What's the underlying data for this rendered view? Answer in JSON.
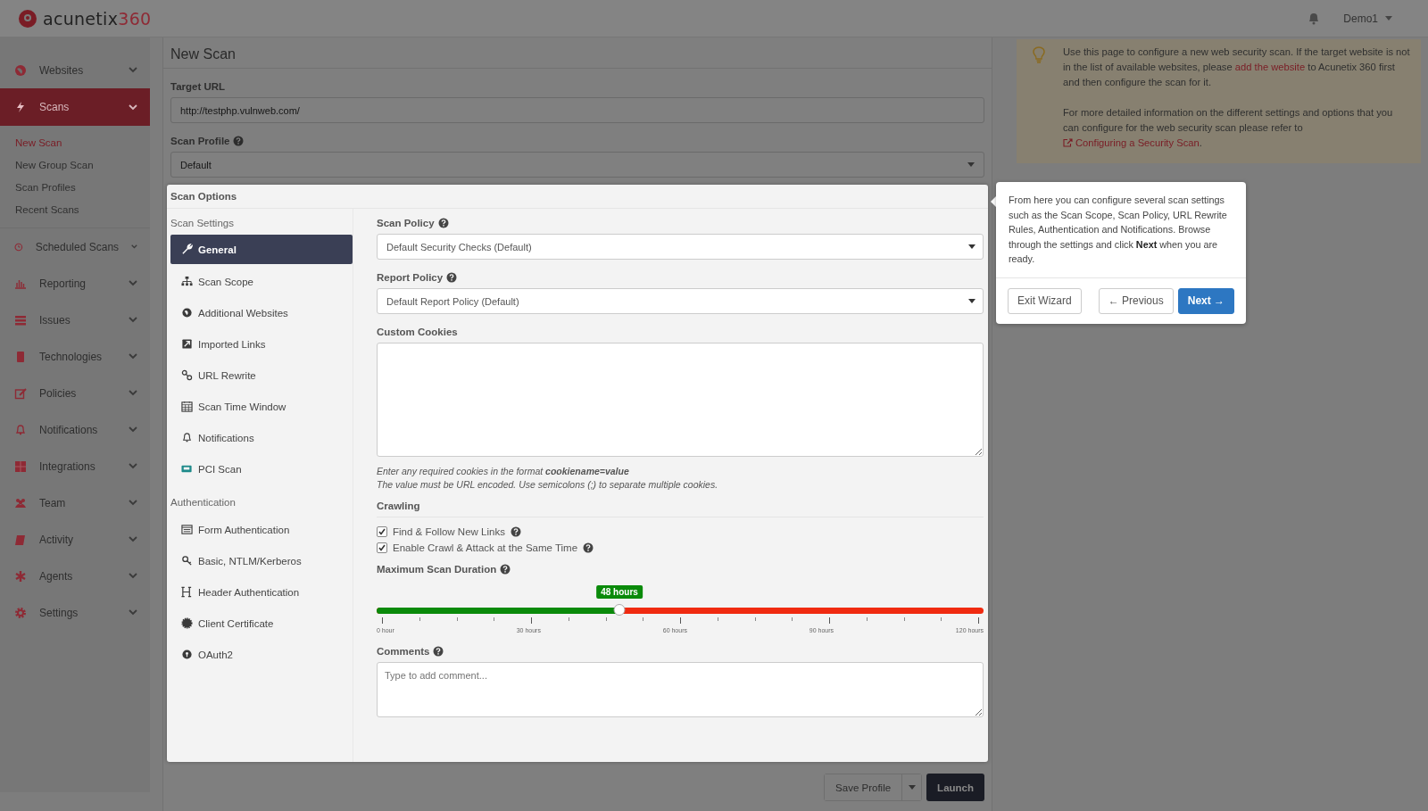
{
  "header": {
    "logo_text": "acunetix",
    "logo_suffix": "360",
    "user": "Demo1"
  },
  "sidebar": {
    "items": [
      {
        "label": "Websites",
        "selected": false
      },
      {
        "label": "Scans",
        "selected": true,
        "children": [
          {
            "label": "New Scan",
            "selected": true
          },
          {
            "label": "New Group Scan",
            "selected": false
          },
          {
            "label": "Scan Profiles",
            "selected": false
          },
          {
            "label": "Recent Scans",
            "selected": false
          }
        ]
      },
      {
        "label": "Scheduled Scans",
        "selected": false
      },
      {
        "label": "Reporting",
        "selected": false
      },
      {
        "label": "Issues",
        "selected": false
      },
      {
        "label": "Technologies",
        "selected": false
      },
      {
        "label": "Policies",
        "selected": false
      },
      {
        "label": "Notifications",
        "selected": false
      },
      {
        "label": "Integrations",
        "selected": false
      },
      {
        "label": "Team",
        "selected": false
      },
      {
        "label": "Activity",
        "selected": false
      },
      {
        "label": "Agents",
        "selected": false
      },
      {
        "label": "Settings",
        "selected": false
      }
    ]
  },
  "page": {
    "title": "New Scan",
    "target_url": {
      "label": "Target URL",
      "value": "http://testphp.vulnweb.com/"
    },
    "scan_profile": {
      "label": "Scan Profile",
      "value": "Default"
    }
  },
  "scan_options": {
    "title": "Scan Options",
    "groups": [
      {
        "heading": "Scan Settings",
        "items": [
          {
            "label": "General",
            "selected": true
          },
          {
            "label": "Scan Scope",
            "selected": false
          },
          {
            "label": "Additional Websites",
            "selected": false
          },
          {
            "label": "Imported Links",
            "selected": false
          },
          {
            "label": "URL Rewrite",
            "selected": false
          },
          {
            "label": "Scan Time Window",
            "selected": false
          },
          {
            "label": "Notifications",
            "selected": false
          },
          {
            "label": "PCI Scan",
            "selected": false
          }
        ]
      },
      {
        "heading": "Authentication",
        "items": [
          {
            "label": "Form Authentication",
            "selected": false
          },
          {
            "label": "Basic, NTLM/Kerberos",
            "selected": false
          },
          {
            "label": "Header Authentication",
            "selected": false
          },
          {
            "label": "Client Certificate",
            "selected": false
          },
          {
            "label": "OAuth2",
            "selected": false
          }
        ]
      }
    ],
    "scan_policy": {
      "label": "Scan Policy",
      "value": "Default Security Checks (Default)"
    },
    "report_policy": {
      "label": "Report Policy",
      "value": "Default Report Policy (Default)"
    },
    "custom_cookies": {
      "label": "Custom Cookies",
      "hints": [
        "Enter any required cookies in the format **cookiename=value**",
        "The value must be URL encoded. Use semicolons (;) to separate multiple cookies."
      ]
    },
    "crawling": {
      "heading": "Crawling",
      "options": [
        {
          "label": "Find & Follow New Links",
          "checked": true
        },
        {
          "label": "Enable Crawl & Attack at the Same Time",
          "checked": true
        }
      ]
    },
    "duration": {
      "label": "Maximum Scan Duration",
      "badge": "48 hours",
      "level": 0.4,
      "tick_labels": [
        "0 hour",
        "30 hours",
        "60 hours",
        "90 hours",
        "120 hours"
      ]
    },
    "comments": {
      "label": "Comments",
      "placeholder": "Type to add comment..."
    }
  },
  "footer": {
    "save": "Save Profile",
    "launch": "Launch"
  },
  "info": {
    "paragraphs": [
      [
        {
          "text": "Use this page to configure a new web security scan. If the target website is not in the list of available websites, please "
        },
        {
          "link": "add the website"
        },
        {
          "text": " to Acunetix 360 first and then configure the scan for it."
        }
      ],
      [
        {
          "text": "For more detailed information on the different settings and options that you can configure for the web security scan please refer to "
        },
        {
          "link": "Configuring a Security Scan",
          "external": true
        },
        {
          "text": "."
        }
      ]
    ]
  },
  "tooltip": {
    "text": "From here you can configure several scan settings such as the Scan Scope, Scan Policy, URL Rewrite Rules, Authentication and Notifications. Browse through the settings and click **Next** when you are ready.",
    "buttons": [
      {
        "label": "Exit Wizard",
        "kind": "default"
      },
      {
        "label": "← Previous",
        "kind": "default"
      },
      {
        "label": "Next →",
        "kind": "primary"
      }
    ]
  }
}
